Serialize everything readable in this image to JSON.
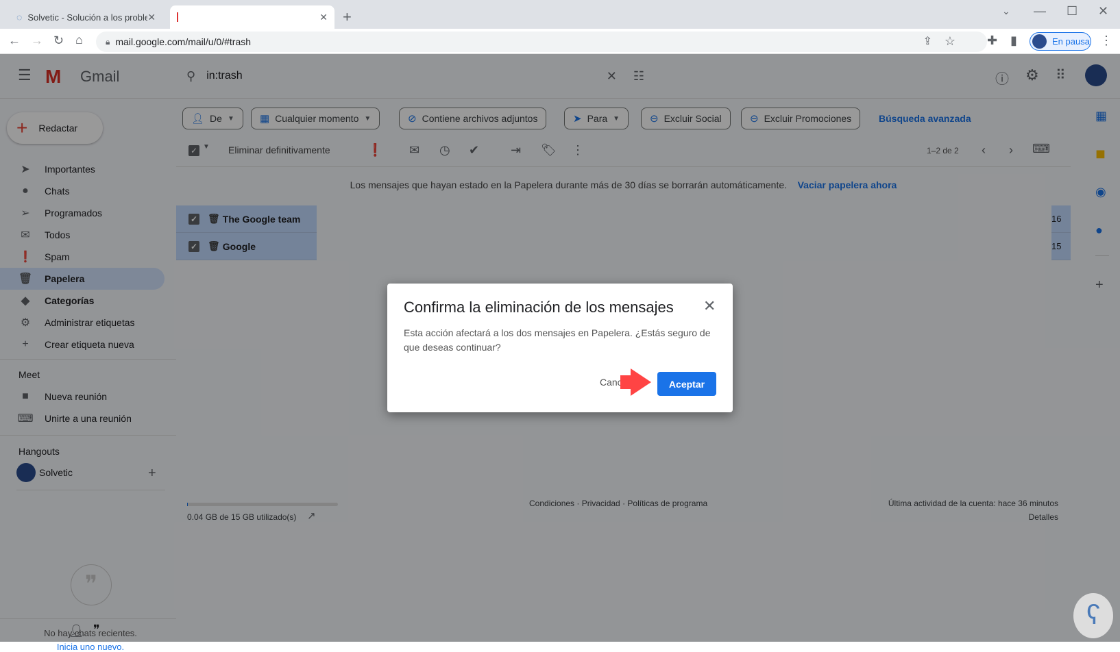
{
  "browser": {
    "tabs": [
      {
        "title": "Solvetic - Solución a los problemas"
      },
      {
        "title": ""
      }
    ],
    "url": "mail.google.com/mail/u/0/#trash",
    "profile_label": "En pausa"
  },
  "gmail": {
    "logo": "Gmail",
    "search_value": "in:trash",
    "compose": "Redactar",
    "chips": [
      "De",
      "Cualquier momento",
      "Contiene archivos adjuntos",
      "Para",
      "Excluir Social",
      "Excluir Promociones"
    ],
    "advanced": "Búsqueda avanzada",
    "toolbar": {
      "delete_forever": "Eliminar definitivamente",
      "pagination": "1–2 de 2"
    },
    "banner": {
      "text": "Los mensajes que hayan estado en la Papelera durante más de 30 días se borrarán automáticamente.",
      "link": "Vaciar papelera ahora"
    },
    "sidebar": {
      "items": [
        {
          "label": "Importantes",
          "icon": "label-important-icon"
        },
        {
          "label": "Chats",
          "icon": "chat-icon"
        },
        {
          "label": "Programados",
          "icon": "scheduled-icon"
        },
        {
          "label": "Todos",
          "icon": "mail-icon"
        },
        {
          "label": "Spam",
          "icon": "spam-icon"
        },
        {
          "label": "Papelera",
          "icon": "trash-icon"
        },
        {
          "label": "Categorías",
          "icon": "label-icon"
        },
        {
          "label": "Administrar etiquetas",
          "icon": "gear-icon"
        },
        {
          "label": "Crear etiqueta nueva",
          "icon": "plus-icon"
        }
      ],
      "meet_title": "Meet",
      "meet_items": [
        "Nueva reunión",
        "Unirte a una reunión"
      ],
      "hangouts_title": "Hangouts",
      "hangouts_user": "Solvetic",
      "no_chats": "No hay chats recientes.",
      "start_new": "Inicia uno nuevo."
    },
    "messages": [
      {
        "sender": "The Google team",
        "date_fragment": "16"
      },
      {
        "sender": "Google",
        "date_fragment": "15"
      }
    ],
    "footer": {
      "storage": "0.04 GB de 15 GB utilizado(s)",
      "storage_used_fraction": 0.003,
      "links": "Condiciones · Privacidad · Políticas de programa",
      "activity": "Última actividad de la cuenta: hace 36 minutos",
      "details": "Detalles"
    }
  },
  "dialog": {
    "title": "Confirma la eliminación de los mensajes",
    "body": "Esta acción afectará a los dos mensajes en Papelera. ¿Estás seguro de que deseas continuar?",
    "cancel": "Cancelar",
    "accept": "Aceptar",
    "accent": "#1a73e8"
  }
}
